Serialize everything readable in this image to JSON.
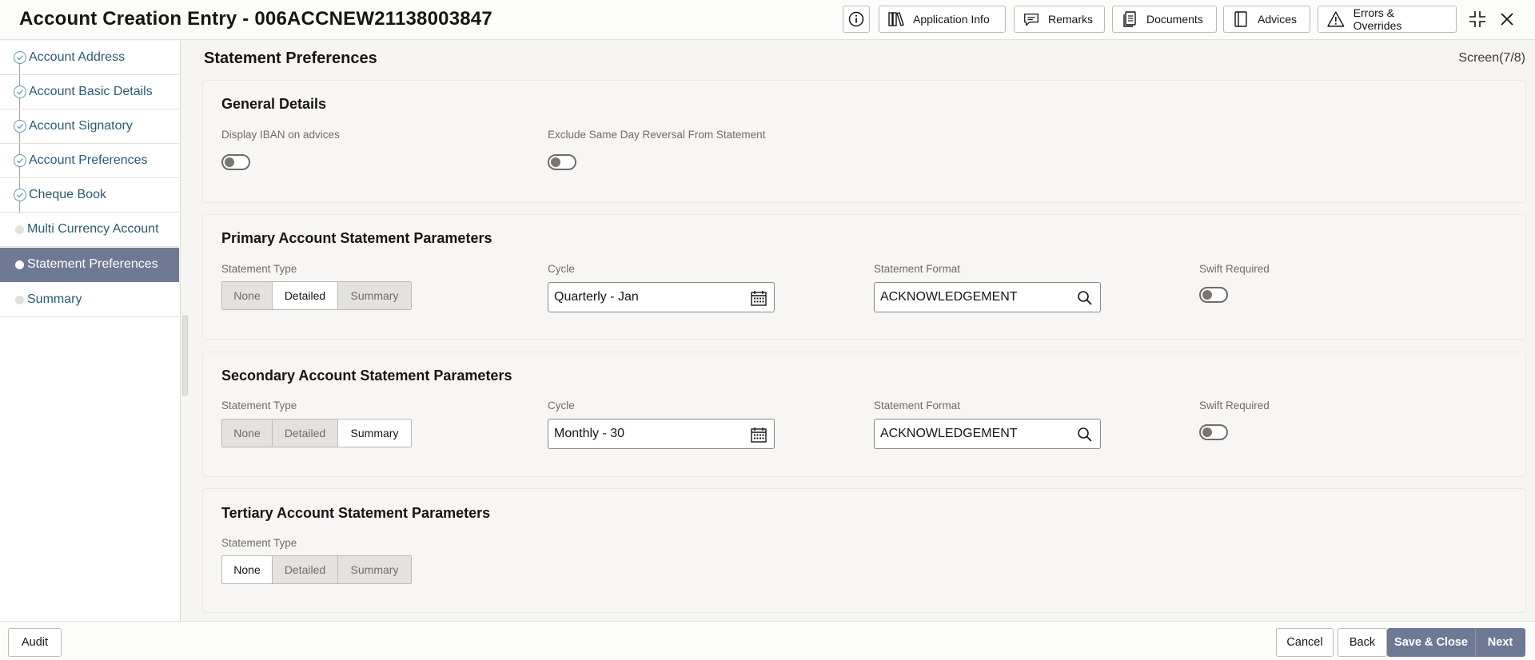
{
  "header": {
    "title": "Account Creation Entry - 006ACCNEW21138003847",
    "buttons": {
      "application_info": "Application Info",
      "remarks": "Remarks",
      "documents": "Documents",
      "advices": "Advices",
      "errors_overrides": "Errors & Overrides"
    },
    "icons": [
      "info-icon",
      "application-info-icon",
      "remarks-icon",
      "documents-icon",
      "advices-icon",
      "warning-icon",
      "collapse-icon",
      "close-icon"
    ]
  },
  "sidebar": {
    "items": [
      {
        "label": "Account Address",
        "state": "completed"
      },
      {
        "label": "Account Basic Details",
        "state": "completed"
      },
      {
        "label": "Account Signatory",
        "state": "completed"
      },
      {
        "label": "Account Preferences",
        "state": "completed"
      },
      {
        "label": "Cheque Book",
        "state": "completed"
      },
      {
        "label": "Multi Currency Account",
        "state": "pending"
      },
      {
        "label": "Statement Preferences",
        "state": "active"
      },
      {
        "label": "Summary",
        "state": "pending"
      }
    ]
  },
  "main": {
    "title": "Statement Preferences",
    "screen": "Screen(7/8)"
  },
  "general": {
    "title": "General Details",
    "display_iban_label": "Display IBAN on advices",
    "display_iban_on": false,
    "exclude_reversal_label": "Exclude Same Day Reversal From Statement",
    "exclude_reversal_on": false
  },
  "primary": {
    "title": "Primary Account Statement Parameters",
    "statement_type_label": "Statement Type",
    "options": [
      "None",
      "Detailed",
      "Summary"
    ],
    "selected": "Detailed",
    "cycle_label": "Cycle",
    "cycle_value": "Quarterly - Jan",
    "format_label": "Statement Format",
    "format_value": "ACKNOWLEDGEMENT",
    "swift_label": "Swift Required",
    "swift_on": false
  },
  "secondary": {
    "title": "Secondary Account Statement Parameters",
    "statement_type_label": "Statement Type",
    "options": [
      "None",
      "Detailed",
      "Summary"
    ],
    "selected": "Summary",
    "cycle_label": "Cycle",
    "cycle_value": "Monthly - 30",
    "format_label": "Statement Format",
    "format_value": "ACKNOWLEDGEMENT",
    "swift_label": "Swift Required",
    "swift_on": false
  },
  "tertiary": {
    "title": "Tertiary Account Statement Parameters",
    "statement_type_label": "Statement Type",
    "options": [
      "None",
      "Detailed",
      "Summary"
    ],
    "selected": "None"
  },
  "footer": {
    "audit": "Audit",
    "cancel": "Cancel",
    "back": "Back",
    "save_close": "Save & Close",
    "next": "Next"
  },
  "colors": {
    "accent": "#6e7a93",
    "link": "#2a5b74",
    "step_line": "#7eb0c1"
  }
}
